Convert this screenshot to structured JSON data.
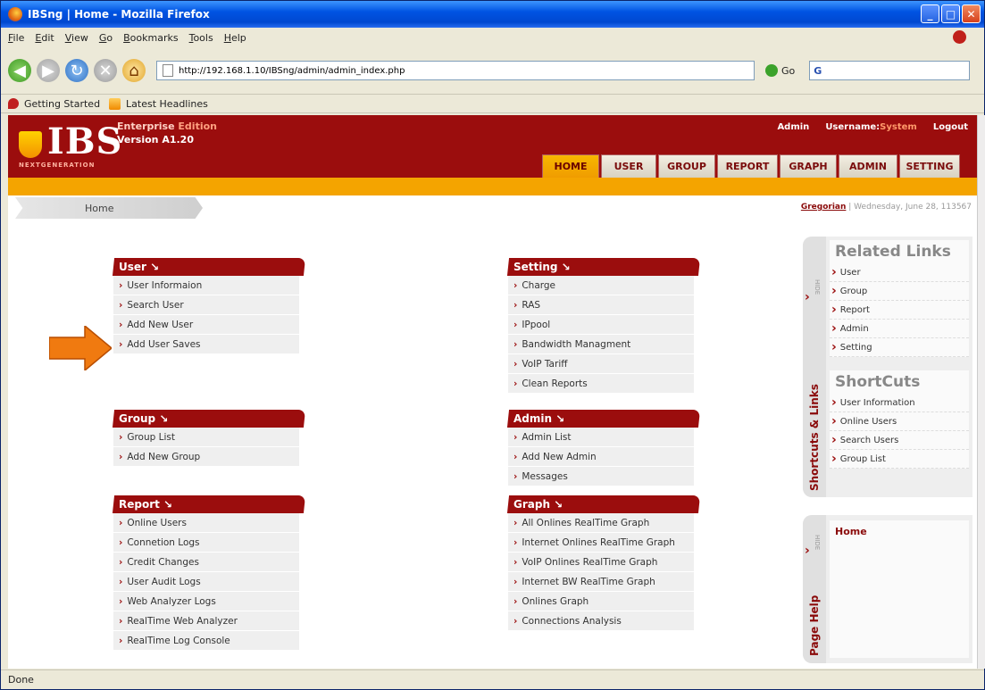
{
  "window": {
    "title": "IBSng | Home - Mozilla Firefox",
    "buttons": [
      "_",
      "□",
      "✕"
    ]
  },
  "menubar": [
    "File",
    "Edit",
    "View",
    "Go",
    "Bookmarks",
    "Tools",
    "Help"
  ],
  "navbar": {
    "url": "http://192.168.1.10/IBSng/admin/admin_index.php",
    "go_label": "Go",
    "search_text": "G"
  },
  "bookmarks": [
    "Getting Started",
    "Latest Headlines"
  ],
  "header": {
    "logo": "IBS",
    "logo_sub": "NEXTGENERATION",
    "edition": "Enterprise",
    "edition_suffix": "Edition",
    "version": "Version A1.20",
    "admin_label": "Admin",
    "username_label": "Username:",
    "username": "System",
    "logout": "Logout"
  },
  "tabs": [
    "HOME",
    "USER",
    "GROUP",
    "REPORT",
    "GRAPH",
    "ADMIN",
    "SETTING"
  ],
  "breadcrumb": "Home",
  "date": {
    "calendar": "Gregorian",
    "text": "| Wednesday, June 28, 113567"
  },
  "panels": {
    "user": {
      "title": "User ↘",
      "items": [
        "User Informaion",
        "Search User",
        "Add New User",
        "Add User Saves"
      ]
    },
    "group": {
      "title": "Group ↘",
      "items": [
        "Group List",
        "Add New Group"
      ]
    },
    "report": {
      "title": "Report ↘",
      "items": [
        "Online Users",
        "Connetion Logs",
        "Credit Changes",
        "User Audit Logs",
        "Web Analyzer Logs",
        "RealTime Web Analyzer",
        "RealTime Log Console"
      ]
    },
    "setting": {
      "title": "Setting ↘",
      "items": [
        "Charge",
        "RAS",
        "IPpool",
        "Bandwidth Managment",
        "VoIP Tariff",
        "Clean Reports"
      ]
    },
    "admin": {
      "title": "Admin ↘",
      "items": [
        "Admin List",
        "Add New Admin",
        "Messages"
      ]
    },
    "graph": {
      "title": "Graph ↘",
      "items": [
        "All Onlines RealTime Graph",
        "Internet Onlines RealTime Graph",
        "VoIP Onlines RealTime Graph",
        "Internet BW RealTime Graph",
        "Onlines Graph",
        "Connections Analysis"
      ]
    }
  },
  "sidebar": {
    "vertical_title": "Shortcuts & Links",
    "hide": "HIDE",
    "related_title": "Related Links",
    "related": [
      "User",
      "Group",
      "Report",
      "Admin",
      "Setting"
    ],
    "shortcuts_title": "ShortCuts",
    "shortcuts": [
      "User Information",
      "Online Users",
      "Search Users",
      "Group List"
    ]
  },
  "help": {
    "vertical_title": "Page Help",
    "hide": "HIDE",
    "content": "Home"
  },
  "status": "Done",
  "colors": {
    "brand_red": "#9b0d0d",
    "accent_orange": "#f4a400",
    "arrow": "#f07a10"
  }
}
